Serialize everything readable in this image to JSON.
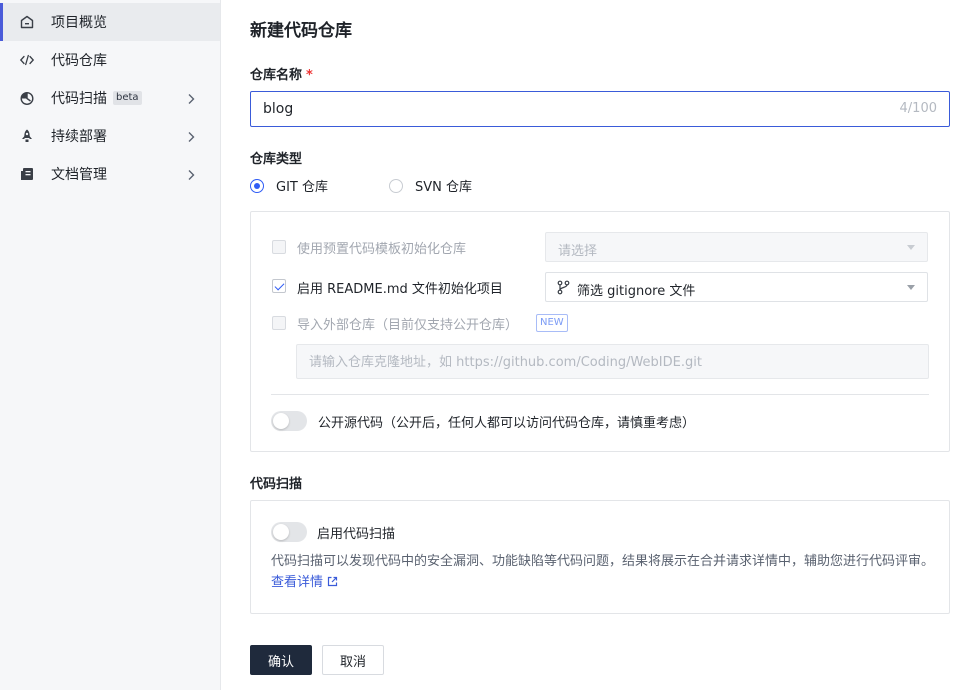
{
  "sidebar": {
    "items": [
      {
        "label": "项目概览",
        "icon": "home-icon",
        "active": true
      },
      {
        "label": "代码仓库",
        "icon": "code-icon"
      },
      {
        "label": "代码扫描",
        "icon": "scan-icon",
        "badge": "beta",
        "expandable": true
      },
      {
        "label": "持续部署",
        "icon": "rocket-icon",
        "expandable": true
      },
      {
        "label": "文档管理",
        "icon": "document-icon",
        "expandable": true
      }
    ]
  },
  "main": {
    "title": "新建代码仓库",
    "repo_name": {
      "label": "仓库名称",
      "required_mark": "*",
      "value": "blog",
      "count": "4/100"
    },
    "repo_type": {
      "label": "仓库类型",
      "options": [
        {
          "label": "GIT 仓库",
          "checked": true
        },
        {
          "label": "SVN 仓库",
          "checked": false
        }
      ]
    },
    "init": {
      "template": {
        "label": "使用预置代码模板初始化仓库",
        "placeholder": "请选择"
      },
      "readme": {
        "label": "启用 README.md 文件初始化项目",
        "select_value": "筛选 gitignore 文件"
      },
      "import": {
        "label": "导入外部仓库（目前仅支持公开仓库）",
        "badge": "NEW",
        "placeholder": "请输入仓库克隆地址，如 https://github.com/Coding/WebIDE.git"
      },
      "public": {
        "label": "公开源代码（公开后，任何人都可以访问代码仓库，请慎重考虑）"
      }
    },
    "scan": {
      "title": "代码扫描",
      "toggle_label": "启用代码扫描",
      "description": "代码扫描可以发现代码中的安全漏洞、功能缺陷等代码问题，结果将展示在合并请求详情中，辅助您进行代码评审。",
      "link": "查看详情"
    },
    "buttons": {
      "confirm": "确认",
      "cancel": "取消"
    }
  },
  "colors": {
    "accent": "#2f5cf5",
    "primary_button": "#1f2a3c",
    "required": "#ee3333"
  }
}
